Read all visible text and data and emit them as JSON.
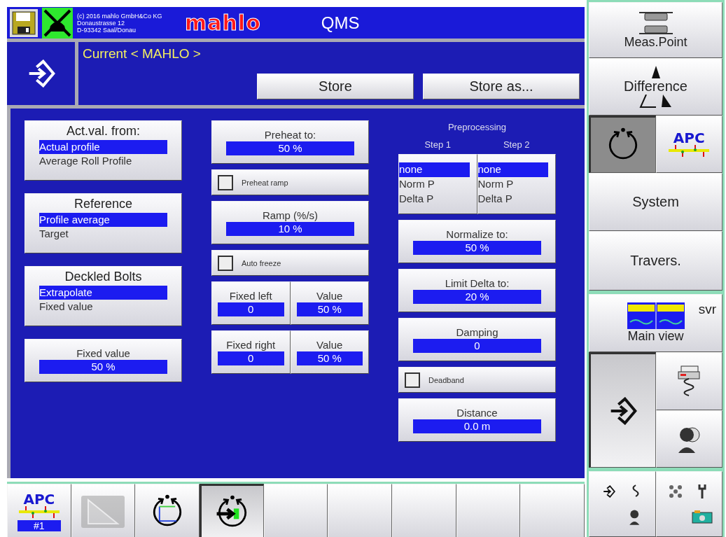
{
  "header": {
    "company_lines": [
      "(c) 2016 mahlo GmbH&Co KG",
      "Donaustrasse 12",
      "D-93342 Saal/Donau"
    ],
    "logo": "mahlo",
    "title": "QMS"
  },
  "current": {
    "label": "Current < MAHLO >",
    "buttons": [
      "Store",
      "Store as..."
    ]
  },
  "column_1": [
    {
      "kind": "list",
      "title": "Act.val. from:",
      "options": [
        {
          "label": "Actual profile",
          "selected": true
        },
        {
          "label": "Average Roll Profile",
          "selected": false
        }
      ]
    },
    {
      "kind": "list",
      "title": "Reference",
      "options": [
        {
          "label": "Profile average",
          "selected": true
        },
        {
          "label": "Target",
          "selected": false
        }
      ]
    },
    {
      "kind": "list",
      "title": "Deckled Bolts",
      "options": [
        {
          "label": "Extrapolate",
          "selected": true
        },
        {
          "label": "Fixed value",
          "selected": false
        }
      ]
    },
    {
      "kind": "value",
      "title": "Fixed value",
      "value": "50 %"
    }
  ],
  "column_2": [
    {
      "kind": "value",
      "title": "Preheat to:",
      "value": "50 %"
    },
    {
      "kind": "checkbox",
      "label": "Preheat ramp",
      "checked": false
    },
    {
      "kind": "value",
      "title": "Ramp (%/s)",
      "value": "10 %"
    },
    {
      "kind": "checkbox",
      "label": "Auto freeze",
      "checked": false
    },
    {
      "kind": "pair",
      "items": [
        {
          "title": "Fixed left",
          "value": "0"
        },
        {
          "title": "Value",
          "value": "50 %"
        }
      ]
    },
    {
      "kind": "pair",
      "items": [
        {
          "title": "Fixed right",
          "value": "0"
        },
        {
          "title": "Value",
          "value": "50 %"
        }
      ]
    }
  ],
  "column_3": {
    "title": "Preprocessing",
    "steps": [
      {
        "title": "Step 1",
        "options": [
          {
            "label": "none",
            "selected": true
          },
          {
            "label": "Norm P",
            "selected": false
          },
          {
            "label": "Delta P",
            "selected": false
          }
        ]
      },
      {
        "title": "Step 2",
        "options": [
          {
            "label": "none",
            "selected": true
          },
          {
            "label": "Norm P",
            "selected": false
          },
          {
            "label": "Delta P",
            "selected": false
          }
        ]
      }
    ],
    "items": [
      {
        "kind": "value",
        "title": "Normalize to:",
        "value": "50 %"
      },
      {
        "kind": "value",
        "title": "Limit Delta to:",
        "value": "20 %"
      },
      {
        "kind": "value",
        "title": "Damping",
        "value": "0"
      },
      {
        "kind": "checkbox",
        "label": "Deadband",
        "checked": false
      },
      {
        "kind": "value",
        "title": "Distance",
        "value": "0.0 m"
      }
    ]
  },
  "side_panel": {
    "meas_point": {
      "label": "Meas.Point"
    },
    "difference": {
      "label": "Difference"
    },
    "rotate": {
      "selected": true
    },
    "apc": {
      "logo": "APC",
      "selected": false
    },
    "system": {
      "label": "System"
    },
    "travers": {
      "label": "Travers."
    },
    "main_view": {
      "label": "Main view",
      "tag": "svr"
    },
    "enter": {
      "selected": true
    },
    "printer": {
      "selected": false
    },
    "person": {
      "selected": false
    }
  },
  "toolbar": [
    {
      "kind": "apc",
      "logo": "APC",
      "label": "#1",
      "selected": false
    },
    {
      "kind": "ruler",
      "disabled": true,
      "selected": false
    },
    {
      "kind": "rotate-axes",
      "selected": false
    },
    {
      "kind": "rotate-enter",
      "selected": true
    },
    {
      "kind": "empty",
      "selected": false
    },
    {
      "kind": "empty",
      "selected": false
    },
    {
      "kind": "empty",
      "selected": false
    },
    {
      "kind": "empty",
      "selected": false
    },
    {
      "kind": "empty",
      "selected": false
    }
  ]
}
